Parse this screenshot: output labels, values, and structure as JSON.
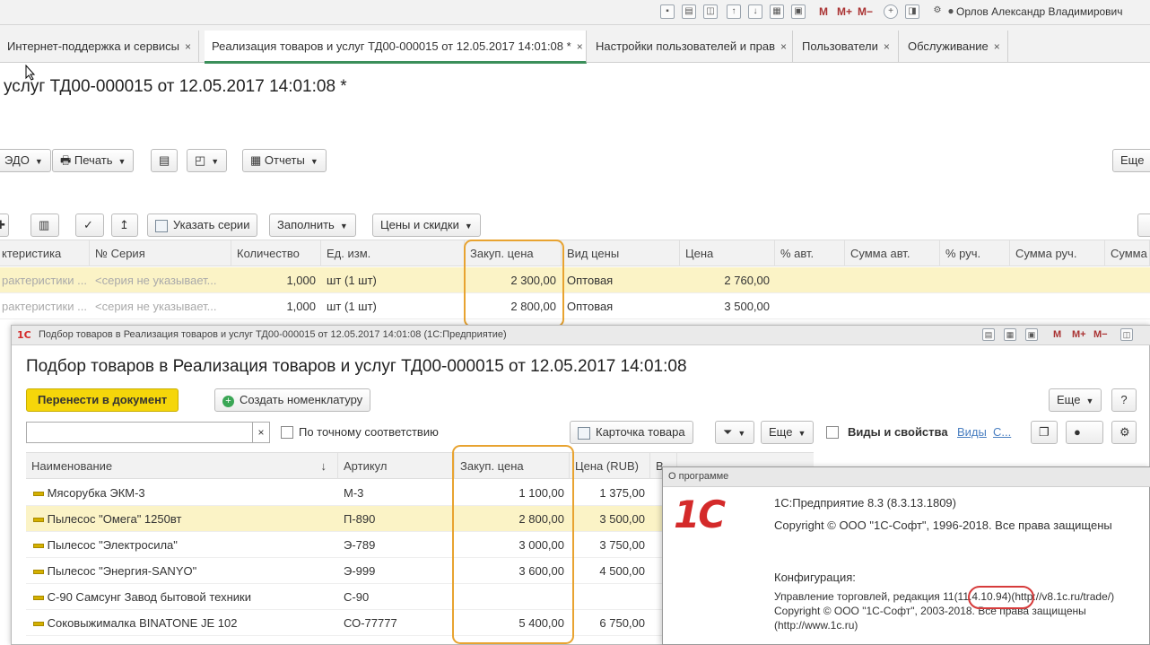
{
  "toolbar": {
    "icon_m": "M",
    "icon_mplus": "M+",
    "icon_mminus": "M−",
    "user_name": "Орлов Александр Владимирович"
  },
  "tabs": [
    {
      "label": "Интернет-поддержка и сервисы",
      "close": "×"
    },
    {
      "label": "Реализация товаров и услуг ТД00-000015 от 12.05.2017 14:01:08 *",
      "close": "×"
    },
    {
      "label": "Настройки пользователей и прав",
      "close": "×"
    },
    {
      "label": "Пользователи",
      "close": "×"
    },
    {
      "label": "Обслуживание",
      "close": "×"
    }
  ],
  "document": {
    "title": "услуг ТД00-000015 от 12.05.2017 14:01:08 *",
    "buttons": {
      "edo": "ЭДО",
      "print": "Печать",
      "reports": "Отчеты",
      "more": "Еще"
    },
    "table_buttons": {
      "specify_series": "Указать серии",
      "fill": "Заполнить",
      "prices_discounts": "Цены и скидки"
    },
    "columns": [
      "ктеристика",
      "Серия",
      "Количество",
      "Ед. изм.",
      "Закуп. цена",
      "Вид цены",
      "Цена",
      "% авт.",
      "Сумма авт.",
      "% руч.",
      "Сумма руч.",
      "Сумма"
    ],
    "series_prefix": "№",
    "rows": [
      {
        "char": "рактеристики ...",
        "series": "<серия не указывает...",
        "qty": "1,000",
        "unit": "шт (1 шт)",
        "purchase_price": "2 300,00",
        "price_type": "Оптовая",
        "price": "2 760,00"
      },
      {
        "char": "рактеристики ...",
        "series": "<серия не указывает...",
        "qty": "1,000",
        "unit": "шт (1 шт)",
        "purchase_price": "2 800,00",
        "price_type": "Оптовая",
        "price": "3 500,00"
      }
    ]
  },
  "picker": {
    "window_title": "Подбор товаров в Реализация товаров и услуг ТД00-000015 от 12.05.2017 14:01:08  (1С:Предприятие)",
    "logo": "1С",
    "heading": "Подбор товаров в Реализация товаров и услуг ТД00-000015 от 12.05.2017 14:01:08",
    "transfer_button": "Перенести в документ",
    "create_button": "Создать номенклатуру",
    "more_button": "Еще",
    "help_button": "?",
    "search_clear": "×",
    "exact_match_label": "По точному соответствию",
    "card_button": "Карточка товара",
    "more2_button": "Еще",
    "views_label": "Виды и свойства",
    "views_link": "Виды",
    "views_link2": "С...",
    "tb_m": "M",
    "tb_mplus": "M+",
    "tb_mminus": "M−",
    "columns": {
      "name": "Наименование",
      "sort": "↓",
      "article": "Артикул",
      "purchase": "Закуп. цена",
      "price": "Цена (RUB)",
      "extra": "В"
    },
    "rows": [
      {
        "name": "Мясорубка ЭКМ-3",
        "article": "М-3",
        "purchase": "1 100,00",
        "price": "1 375,00"
      },
      {
        "name": "Пылесос \"Омега\" 1250вт",
        "article": "П-890",
        "purchase": "2 800,00",
        "price": "3 500,00"
      },
      {
        "name": "Пылесос \"Электросила\"",
        "article": "Э-789",
        "purchase": "3 000,00",
        "price": "3 750,00"
      },
      {
        "name": "Пылесос \"Энергия-SANYO\"",
        "article": "Э-999",
        "purchase": "3 600,00",
        "price": "4 500,00"
      },
      {
        "name": "С-90 Самсунг Завод бытовой техники",
        "article": "С-90",
        "purchase": "",
        "price": ""
      },
      {
        "name": "Соковыжималка  BINATONE JE 102",
        "article": "СО-77777",
        "purchase": "5 400,00",
        "price": "6 750,00"
      }
    ]
  },
  "about": {
    "window_title": "О программе",
    "logo": "1С",
    "platform": "1С:Предприятие 8.3 (8.3.13.1809)",
    "copyright1": "Copyright © ООО \"1С-Софт\", 1996-2018. Все права защищены",
    "config_label": "Конфигурация:",
    "config_prefix": "Управление торговлей, редакция 11",
    "config_version": "(11.4.10.94)",
    "config_url": "(http://v8.1c.ru/trade/)",
    "copyright2": "Copyright © ООО \"1С-Софт\", 2003-2018. Все права защищены",
    "copyright2_url": "(http://www.1c.ru)"
  },
  "colors": {
    "accent_tab": "#3b8f5a",
    "selected_row": "#fbf3c6",
    "highlight_orange": "#e8a330",
    "highlight_red": "#d63b3b",
    "yellow_button": "#f5d60a",
    "logo_red": "#d42a2a"
  }
}
